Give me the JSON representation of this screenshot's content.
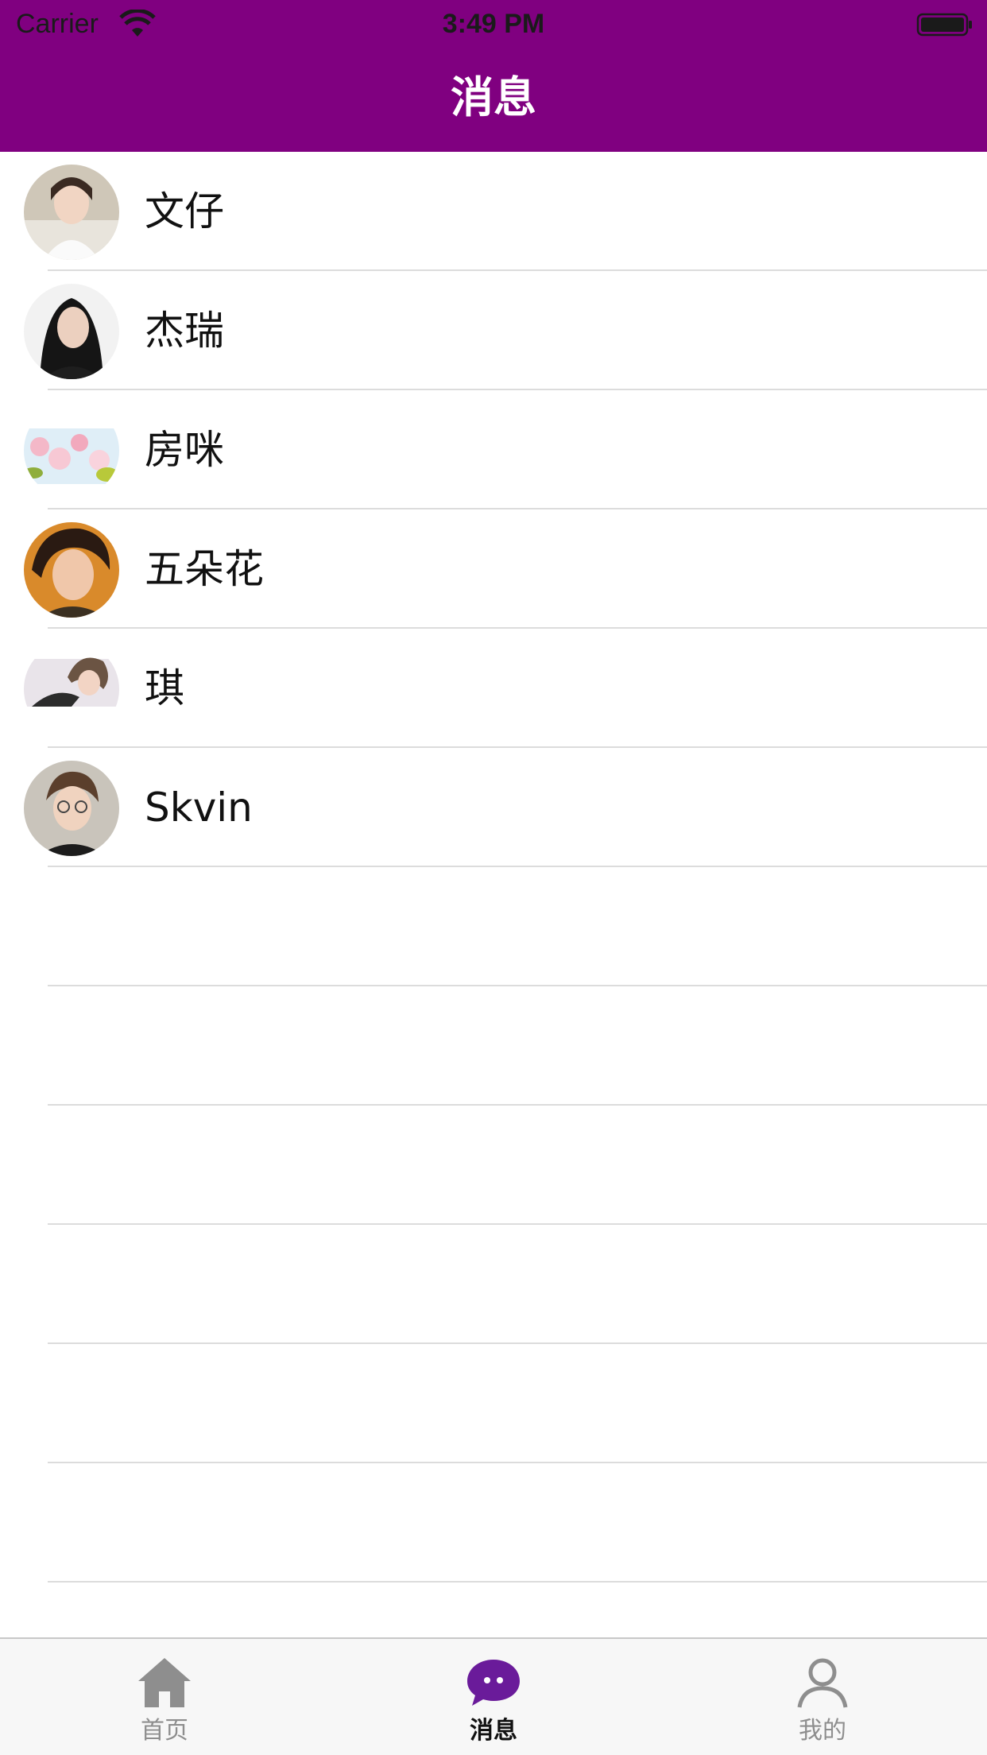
{
  "status_bar": {
    "carrier": "Carrier",
    "time": "3:49 PM",
    "wifi_icon": "wifi-icon",
    "battery_icon": "battery-icon"
  },
  "nav": {
    "title": "消息",
    "background_color": "#800080"
  },
  "messages": [
    {
      "name": "文仔",
      "avatar": "avatar-photo"
    },
    {
      "name": "杰瑞",
      "avatar": "avatar-photo"
    },
    {
      "name": "房咪",
      "avatar": "avatar-photo"
    },
    {
      "name": "五朵花",
      "avatar": "avatar-photo"
    },
    {
      "name": "琪",
      "avatar": "avatar-photo"
    },
    {
      "name": "Skvin",
      "avatar": "avatar-photo"
    }
  ],
  "tabbar": {
    "tabs": [
      {
        "label": "首页",
        "icon": "home-icon",
        "active": false
      },
      {
        "label": "消息",
        "icon": "chat-bubble-icon",
        "active": true
      },
      {
        "label": "我的",
        "icon": "person-icon",
        "active": false
      }
    ],
    "active_color": "#6a1b9a",
    "inactive_color": "#8e8e8e"
  }
}
